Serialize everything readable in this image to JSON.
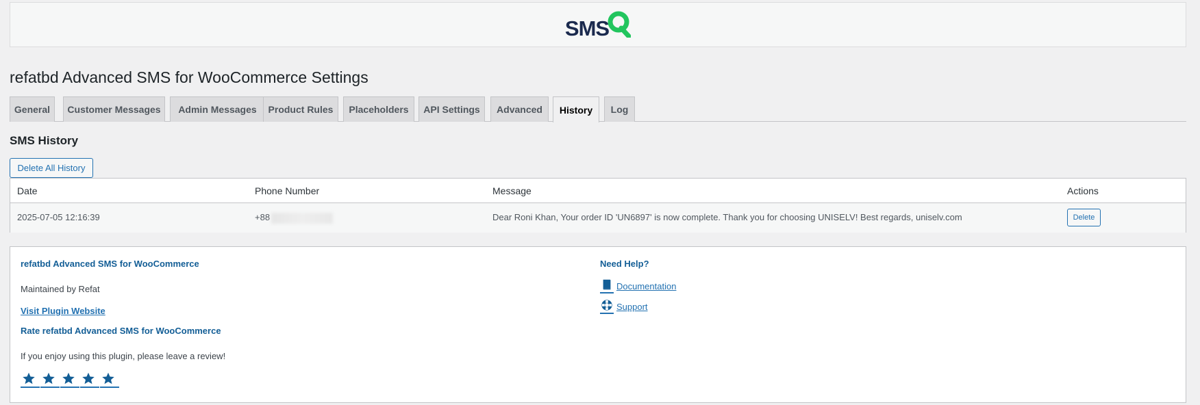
{
  "logo": {
    "text": "SMS",
    "brand_color": "#1b2a4e",
    "accent_color": "#22c55e"
  },
  "page_title": "refatbd Advanced SMS for WooCommerce Settings",
  "tabs": [
    {
      "label": "General"
    },
    {
      "label": "Customer Messages"
    },
    {
      "label": "Admin Messages"
    },
    {
      "label": "Product Rules"
    },
    {
      "label": "Placeholders"
    },
    {
      "label": "API Settings"
    },
    {
      "label": "Advanced"
    },
    {
      "label": "History",
      "active": true
    },
    {
      "label": "Log"
    }
  ],
  "section_title": "SMS History",
  "delete_all_label": "Delete All History",
  "table": {
    "headers": {
      "date": "Date",
      "phone": "Phone Number",
      "message": "Message",
      "actions": "Actions"
    },
    "rows": [
      {
        "date": "2025-07-05 12:16:39",
        "phone": "+88",
        "message": "Dear Roni Khan, Your order ID 'UN6897' is now complete. Thank you for choosing UNISELV! Best regards, uniselv.com",
        "action": "Delete"
      }
    ]
  },
  "footer": {
    "plugin_name": "refatbd Advanced SMS for WooCommerce",
    "maintained": "Maintained by Refat",
    "visit_link": "Visit Plugin Website",
    "rate_title": "Rate refatbd Advanced SMS for WooCommerce",
    "review_text": "If you enjoy using this plugin, please leave a review!",
    "rating": {
      "stars": 5,
      "icon": "star-icon"
    },
    "help_title": "Need Help?",
    "documentation": {
      "label": " Documentation",
      "icon": "book-icon"
    },
    "support": {
      "label": " Support",
      "icon": "lifebuoy-icon"
    }
  },
  "colors": {
    "link": "#2271b1",
    "heading_blue": "#135e96",
    "background": "#f0f0f1"
  }
}
